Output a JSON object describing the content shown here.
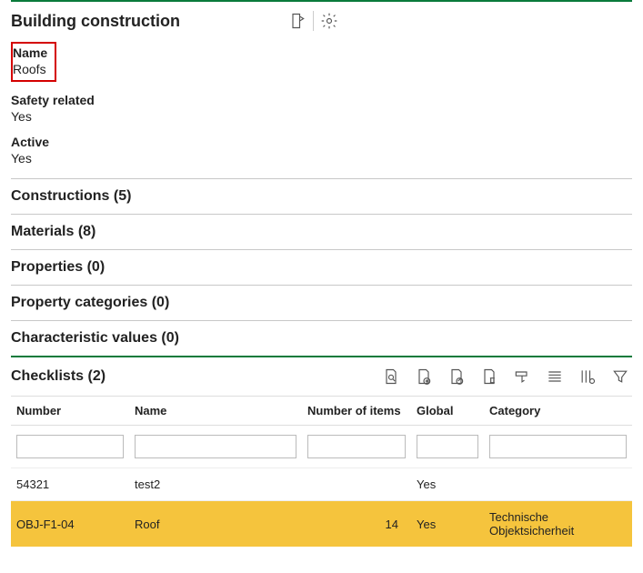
{
  "header": {
    "title": "Building construction"
  },
  "fields": {
    "name_label": "Name",
    "name_value": "Roofs",
    "safety_label": "Safety related",
    "safety_value": "Yes",
    "active_label": "Active",
    "active_value": "Yes"
  },
  "sections": {
    "constructions": "Constructions (5)",
    "materials": "Materials (8)",
    "properties": "Properties (0)",
    "property_categories": "Property categories (0)",
    "characteristic_values": "Characteristic values (0)"
  },
  "checklists": {
    "title": "Checklists (2)",
    "columns": {
      "number": "Number",
      "name": "Name",
      "count": "Number of items",
      "global": "Global",
      "category": "Category"
    },
    "rows": [
      {
        "number": "54321",
        "name": "test2",
        "count": "",
        "global": "Yes",
        "category": ""
      },
      {
        "number": "OBJ-F1-04",
        "name": "Roof",
        "count": "14",
        "global": "Yes",
        "category": "Technische Objektsicherheit"
      }
    ]
  }
}
